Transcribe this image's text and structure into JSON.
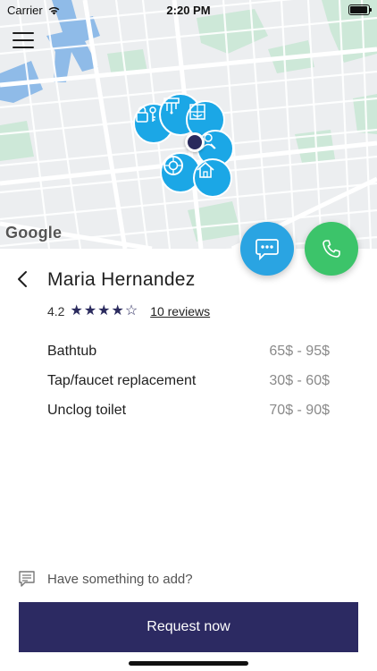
{
  "status_bar": {
    "carrier": "Carrier",
    "time": "2:20 PM",
    "battery_level": 0.95
  },
  "map": {
    "attribution": "Google",
    "water_color": "#8fbbe8",
    "park_color": "#cde8d8",
    "road_color": "#ffffff",
    "pin_color": "#1ba7e6",
    "pins": [
      {
        "icon": "lock-key-icon"
      },
      {
        "icon": "tools-icon"
      },
      {
        "icon": "bathroom-icon"
      },
      {
        "icon": "plumber-icon"
      },
      {
        "icon": "tire-icon"
      },
      {
        "icon": "house-icon"
      }
    ]
  },
  "actions": {
    "chat_icon": "chat-bubble-icon",
    "call_icon": "phone-icon",
    "chat_color": "#2aa4e2",
    "call_color": "#3cc46a"
  },
  "provider": {
    "name": "Maria Hernandez",
    "rating": "4.2",
    "rating_value": 4.2,
    "rating_max": 5,
    "reviews_label": "10 reviews"
  },
  "services": [
    {
      "name": "Bathtub",
      "price": "65$ - 95$"
    },
    {
      "name": "Tap/faucet replacement",
      "price": "30$ - 60$"
    },
    {
      "name": "Unclog toilet",
      "price": "70$ - 90$"
    }
  ],
  "comment": {
    "placeholder": "Have something to add?",
    "icon": "note-icon"
  },
  "request_button": {
    "label": "Request now",
    "color": "#2c2a62"
  }
}
